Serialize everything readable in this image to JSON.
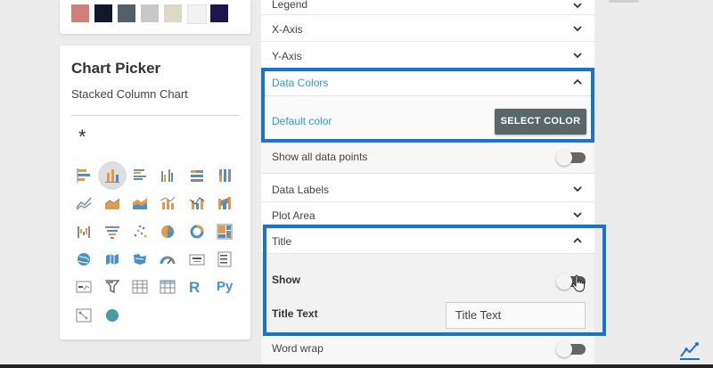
{
  "swatches": [
    "#d07f7a",
    "#0e1a2a",
    "#53606a",
    "#c8c8c8",
    "#ddd9c4",
    "#f2f2f2",
    "#1f1450"
  ],
  "chart_picker": {
    "title": "Chart Picker",
    "selected_chart": "Stacked Column Chart",
    "asterisk": "*",
    "icon_rows": [
      [
        "bar-chart-icon",
        "stacked-column-chart-icon",
        "clustered-bar-chart-icon",
        "clustered-column-chart-icon",
        "100-stacked-bar-chart-icon",
        "100-stacked-column-chart-icon"
      ],
      [
        "line-chart-icon",
        "area-chart-icon",
        "stacked-area-chart-icon",
        "line-column-chart-icon",
        "line-stacked-column-chart-icon",
        "ribbon-chart-icon"
      ],
      [
        "waterfall-chart-icon",
        "funnel-chart-icon",
        "scatter-chart-icon",
        "pie-chart-icon",
        "donut-chart-icon",
        "treemap-icon"
      ],
      [
        "map-icon",
        "filled-map-icon",
        "shape-map-icon",
        "gauge-icon",
        "card-icon",
        "multi-row-card-icon"
      ],
      [
        "kpi-icon",
        "slicer-icon",
        "table-icon",
        "matrix-icon",
        "r-visual-icon",
        "python-visual-icon"
      ],
      [
        "key-influencers-icon",
        "globe-icon"
      ]
    ],
    "text_icons": {
      "r": "R",
      "py": "Py"
    }
  },
  "settings": {
    "legend": "Legend",
    "x_axis": "X-Axis",
    "y_axis": "Y-Axis",
    "data_colors": {
      "label": "Data Colors",
      "default_color_label": "Default color",
      "select_color_button": "SELECT COLOR"
    },
    "show_all_data_points": "Show all data points",
    "data_labels": "Data Labels",
    "plot_area": "Plot Area",
    "title_section": {
      "label": "Title",
      "show_label": "Show",
      "title_text_label": "Title Text",
      "title_text_value": "Title Text"
    },
    "word_wrap": "Word wrap"
  },
  "colors": {
    "accent_blue": "#1a73d0",
    "link_blue": "#2b9bd8",
    "button_gray": "#586768"
  }
}
